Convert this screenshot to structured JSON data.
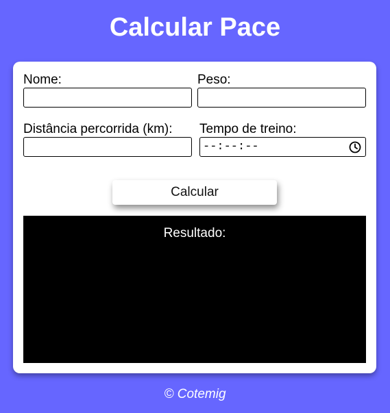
{
  "page": {
    "title": "Calcular Pace",
    "background_color": "#6666ff"
  },
  "form": {
    "nome_label": "Nome:",
    "nome_value": "",
    "peso_label": "Peso:",
    "peso_value": "",
    "distancia_label": "Distância percorrida (km):",
    "distancia_value": "",
    "tempo_label": "Tempo de treino:",
    "tempo_placeholder": "--:--:--",
    "tempo_icon": "clock-icon",
    "calcular_label": "Calcular"
  },
  "result": {
    "label": "Resultado:",
    "background_color": "#000000"
  },
  "footer": {
    "text": "© Cotemig"
  }
}
